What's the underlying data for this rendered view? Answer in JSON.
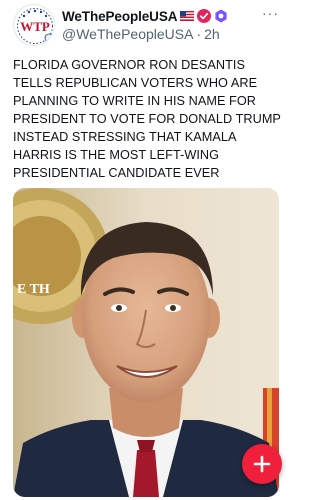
{
  "post": {
    "display_name": "WeThePeopleUSA",
    "handle": "@WeThePeopleUSA",
    "separator": "·",
    "time": "2h",
    "text": "FLORIDA GOVERNOR RON DESANTIS TELLS REPUBLICAN VOTERS WHO ARE PLANNING TO WRITE IN HIS NAME FOR PRESIDENT TO VOTE FOR DONALD TRUMP INSTEAD STRESSING THAT KAMALA HARRIS IS THE MOST LEFT-WING PRESIDENTIAL CANDIDATE EVER",
    "avatar_logo_text": "WTP",
    "more_label": "···"
  },
  "icons": {
    "more": "more-options-icon",
    "flag": "us-flag-icon",
    "verified": "verified-badge-icon",
    "affiliate": "affiliate-badge-icon",
    "compose": "plus-icon"
  },
  "colors": {
    "fab": "#f0203c",
    "verified": "#e0245e",
    "affiliate": "#7856ff",
    "secondary_text": "#536471"
  }
}
